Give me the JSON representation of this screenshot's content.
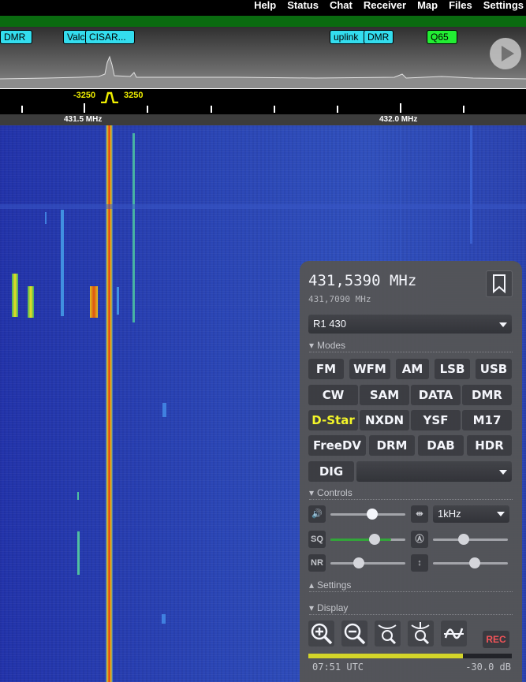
{
  "menu": [
    "Help",
    "Status",
    "Chat",
    "Receiver",
    "Map",
    "Files",
    "Settings"
  ],
  "spectrum": {
    "tags": [
      {
        "label": "DMR",
        "color": "cyan"
      },
      {
        "label": "Valc",
        "color": "cyan"
      },
      {
        "label": "CISAR...",
        "color": "cyan"
      },
      {
        "label": "uplink",
        "color": "cyan"
      },
      {
        "label": "DMR",
        "color": "cyan"
      },
      {
        "label": "Q65",
        "color": "green"
      }
    ],
    "bw_low": "-3250",
    "bw_high": "3250"
  },
  "scale": {
    "labels": [
      "431.5 MHz",
      "432.0 MHz"
    ]
  },
  "panel": {
    "frequency": "431,5390 MHz",
    "offset_frequency": "431,7090 MHz",
    "profile": "R1 430",
    "sections": {
      "modes": "Modes",
      "controls": "Controls",
      "settings": "Settings",
      "display": "Display"
    },
    "modes": [
      "FM",
      "WFM",
      "AM",
      "LSB",
      "USB",
      "CW",
      "SAM",
      "DATA",
      "DMR",
      "D-Star",
      "NXDN",
      "YSF",
      "M17",
      "FreeDV",
      "DRM",
      "DAB",
      "HDR",
      "DIG"
    ],
    "active_mode": "D-Star",
    "digital_select": "",
    "step": "1kHz",
    "sq_label": "SQ",
    "nr_label": "NR",
    "rec_label": "REC",
    "meter_level": 0.76,
    "clock": "07:51 UTC",
    "db": "-30.0 dB",
    "sliders": {
      "volume": 0.68,
      "squelch": 0.58,
      "nr": 0.36,
      "agc": 0.4,
      "gain": 0.55
    },
    "colors": {
      "active": "#ffff22",
      "meter": "#dddd22",
      "rec": "#ff5555"
    }
  }
}
